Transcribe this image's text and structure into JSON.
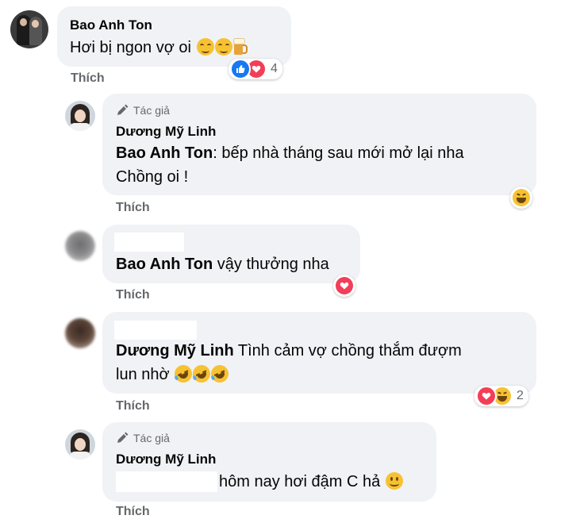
{
  "comments": [
    {
      "author": "Bao Anh Ton",
      "text": "Hơi bị ngon vợ oi",
      "emojis": [
        "blush-emoji",
        "blush-emoji",
        "beer-emoji"
      ],
      "reactions": [
        "like",
        "love"
      ],
      "reaction_count": "4",
      "like_label": "Thích"
    },
    {
      "author_badge": "Tác giả",
      "author": "Dương Mỹ Linh",
      "mention": "Bao Anh Ton",
      "text": ": bếp nhà tháng sau mới mở lại nha",
      "text2": "Chồng oi !",
      "reactions": [
        "haha"
      ],
      "like_label": "Thích"
    },
    {
      "author": "",
      "mention": "Bao Anh Ton",
      "text": " vậy thưởng nha",
      "reactions": [
        "love"
      ],
      "like_label": "Thích"
    },
    {
      "author": "",
      "mention": "Dương Mỹ Linh",
      "text": " Tình cảm vợ chồng thắm đượm",
      "text2": "lun nhờ",
      "emojis": [
        "rofl-emoji",
        "rofl-emoji",
        "rofl-emoji"
      ],
      "reactions": [
        "love",
        "haha"
      ],
      "reaction_count": "2",
      "like_label": "Thích"
    },
    {
      "author_badge": "Tác giả",
      "author": "Dương Mỹ Linh",
      "text": "hôm nay hơi đậm C hả",
      "emojis": [
        "smile-emoji"
      ],
      "like_label": "Thích"
    }
  ],
  "colors": {
    "bubble": "#f0f2f5",
    "meta": "#65676b",
    "like_blue": "#1877f2",
    "love_red": "#f33e58",
    "haha_yellow": "#f7c232"
  }
}
